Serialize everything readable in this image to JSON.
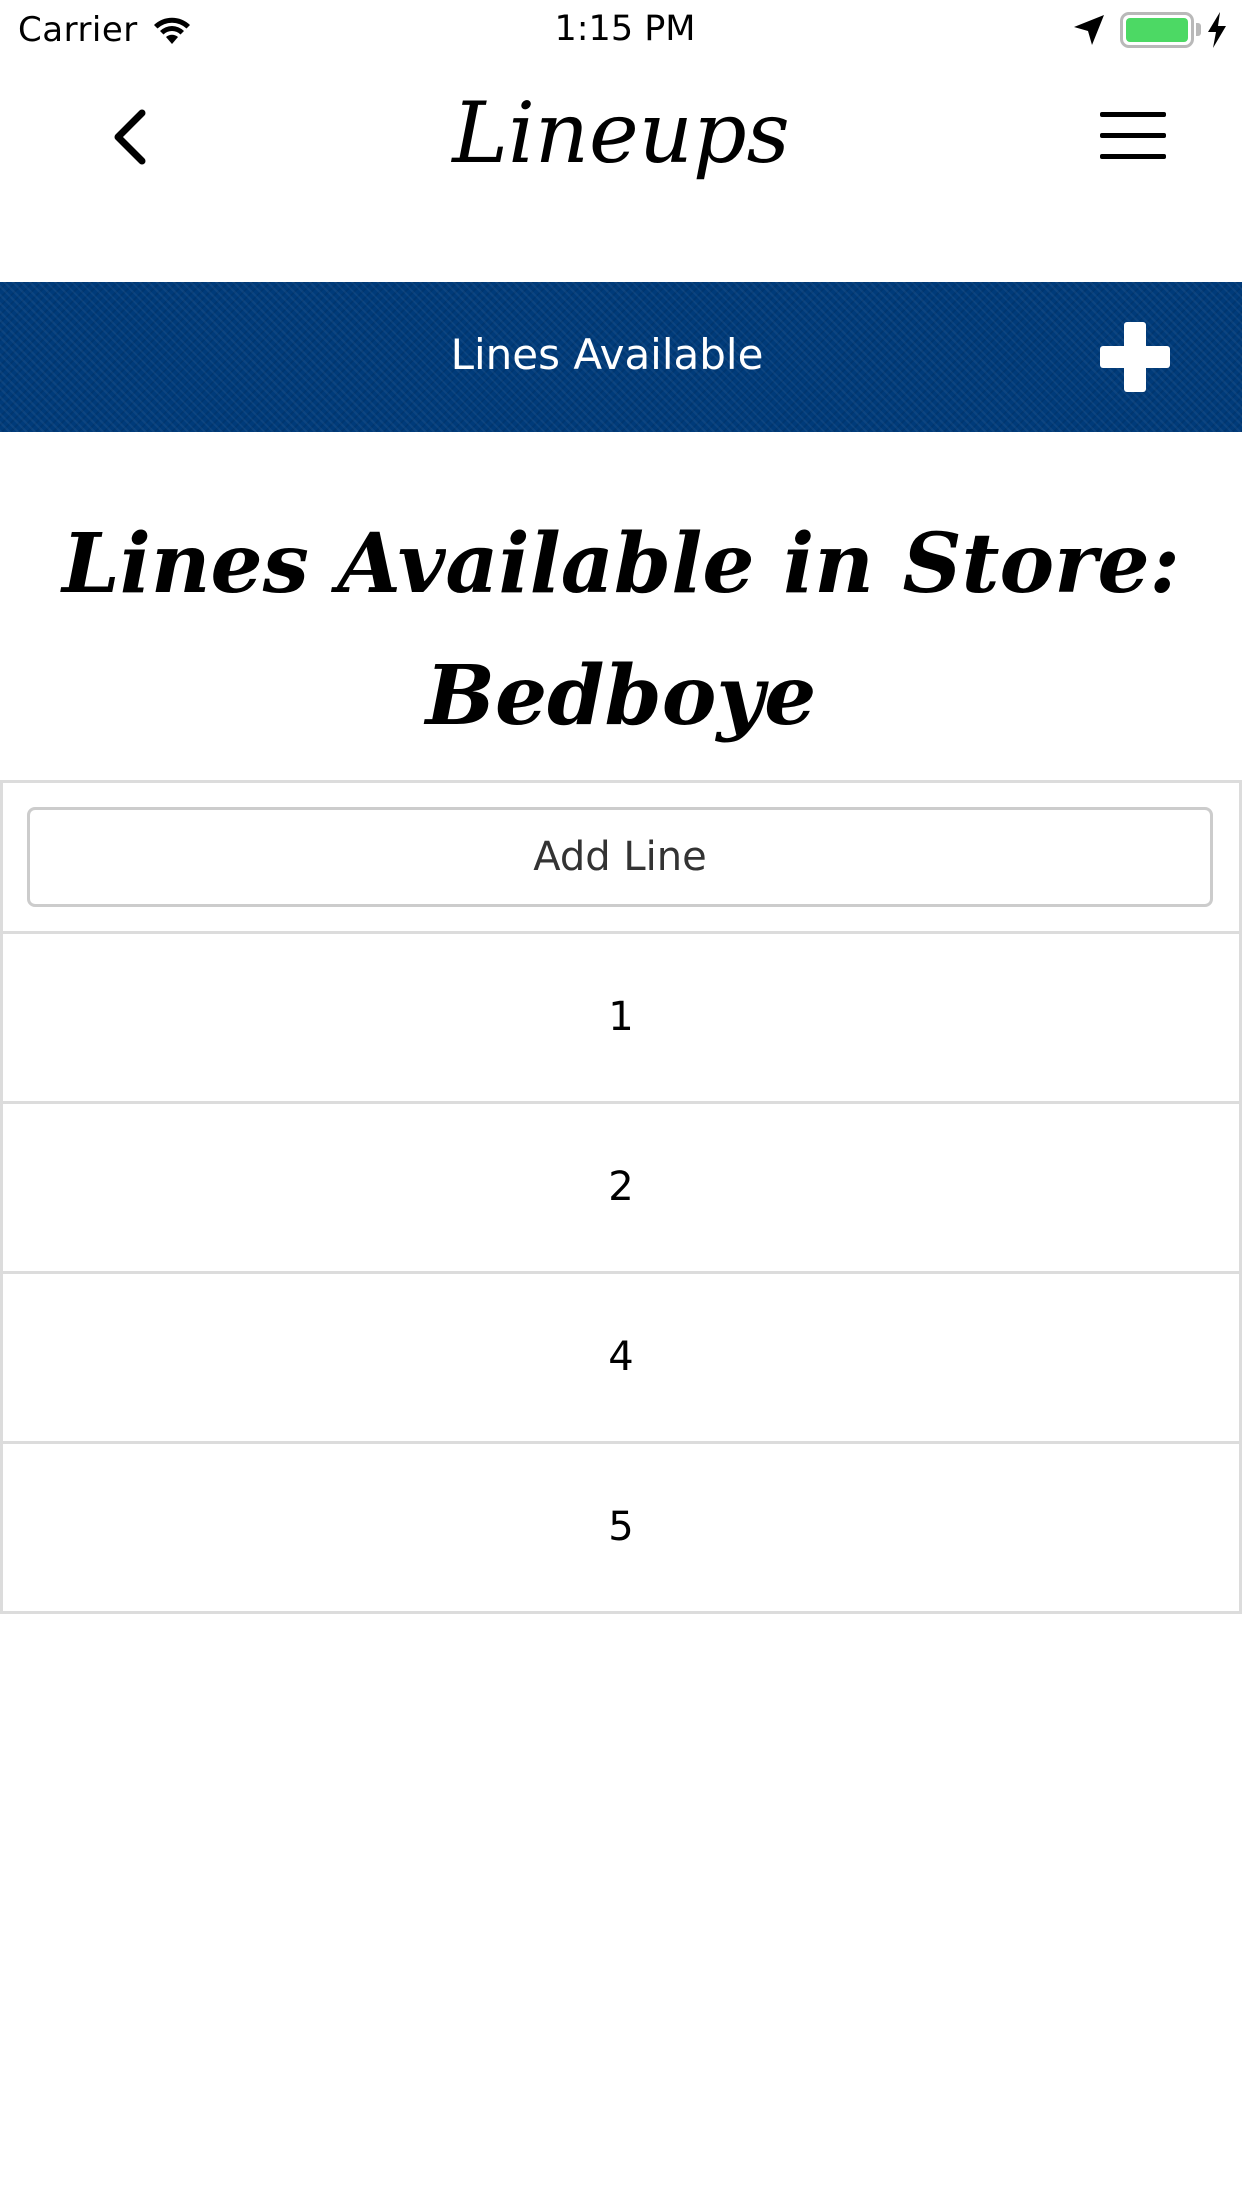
{
  "status_bar": {
    "carrier": "Carrier",
    "time": "1:15 PM",
    "battery_level": 1.0,
    "battery_color": "#4cd964",
    "icons": [
      "wifi-icon",
      "location-arrow-icon",
      "battery-icon",
      "charging-bolt-icon"
    ]
  },
  "nav": {
    "title": "Lineups",
    "back_icon": "chevron-left-icon",
    "menu_icon": "hamburger-menu-icon"
  },
  "banner": {
    "title": "Lines Available",
    "action_icon": "plus-icon",
    "background_color": "#003b7a"
  },
  "heading": {
    "line1": "Lines Available in Store:",
    "line2": "Bedboye"
  },
  "list": {
    "add_button_label": "Add Line",
    "items": [
      {
        "label": "1"
      },
      {
        "label": "2"
      },
      {
        "label": "4"
      },
      {
        "label": "5"
      }
    ]
  }
}
